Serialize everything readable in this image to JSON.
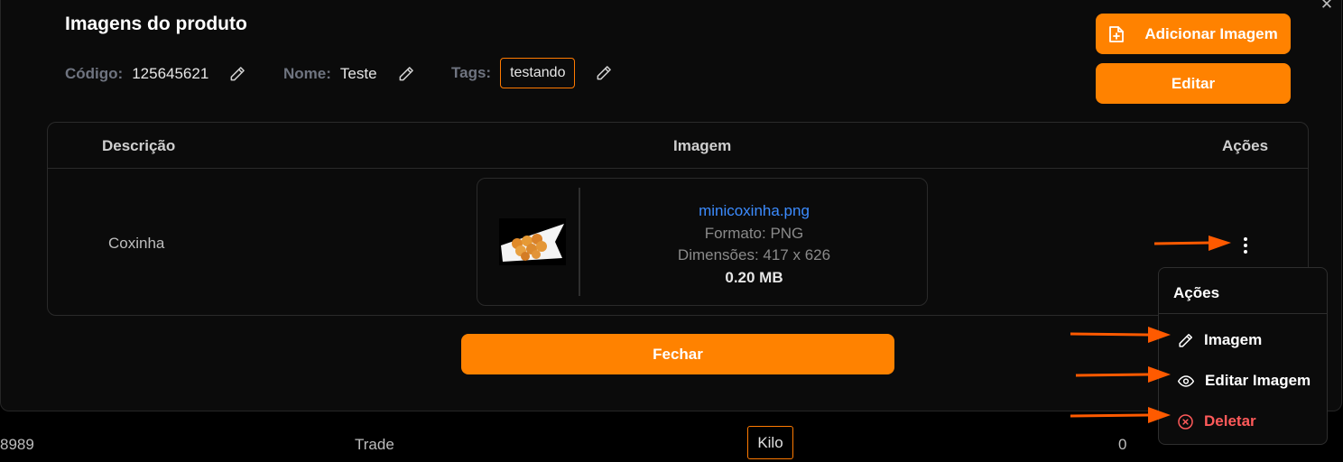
{
  "modal": {
    "title": "Imagens do produto",
    "close_glyph": "✕",
    "code_label": "Código:",
    "code_value": "125645621",
    "name_label": "Nome:",
    "name_value": "Teste",
    "tags_label": "Tags:",
    "tags": [
      "testando"
    ],
    "add_image_label": "Adicionar Imagem",
    "edit_label": "Editar",
    "close_label": "Fechar"
  },
  "table": {
    "headers": [
      "Descrição",
      "Imagem",
      "Ações"
    ],
    "rows": [
      {
        "description": "Coxinha",
        "image": {
          "filename": "minicoxinha.png",
          "format": "Formato: PNG",
          "dimensions": "Dimensões: 417 x 626",
          "size": "0.20 MB"
        }
      }
    ]
  },
  "actions_menu": {
    "title": "Ações",
    "items": [
      {
        "label": "Imagem",
        "icon": "pencil-icon",
        "color": "#ffffff"
      },
      {
        "label": "Editar Imagem",
        "icon": "eye-icon",
        "color": "#ffffff"
      },
      {
        "label": "Deletar",
        "icon": "x-circle-icon",
        "color": "#ff5a5a"
      }
    ]
  },
  "background_row": {
    "id_fragment": "8989",
    "type": "Trade",
    "unit": "Kilo",
    "count": "0"
  },
  "colors": {
    "accent": "#ff8200",
    "annotation_arrow": "#ff5a00",
    "link": "#3c8cff",
    "danger": "#ff5a5a"
  }
}
